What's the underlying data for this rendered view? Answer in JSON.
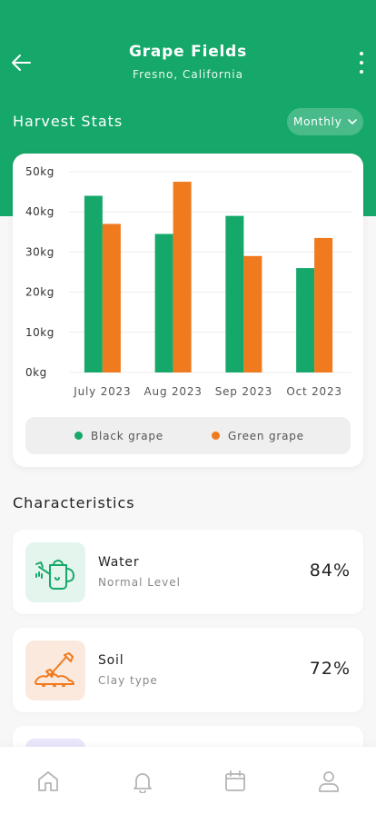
{
  "header": {
    "title": "Grape Fields",
    "subtitle": "Fresno, California",
    "back_icon": "arrow-left-icon",
    "menu_icon": "more-vertical-icon"
  },
  "stats": {
    "heading": "Harvest Stats",
    "range_label": "Monthly",
    "range_icon": "chevron-down-icon"
  },
  "chart_data": {
    "type": "bar",
    "categories": [
      "July 2023",
      "Aug 2023",
      "Sep 2023",
      "Oct 2023"
    ],
    "series": [
      {
        "name": "Black grape",
        "color": "#16a86a",
        "values": [
          44,
          34.5,
          39,
          26
        ]
      },
      {
        "name": "Green grape",
        "color": "#f07a1e",
        "values": [
          37,
          47.5,
          29,
          33.5
        ]
      }
    ],
    "yticks": [
      "0kg",
      "10kg",
      "20kg",
      "30kg",
      "40kg",
      "50kg"
    ],
    "ylim": [
      0,
      50
    ],
    "grid": true,
    "legend": "bottom"
  },
  "characteristics": {
    "heading": "Characteristics",
    "items": [
      {
        "name": "Water",
        "desc": "Normal Level",
        "value": "84%",
        "icon": "watering-can-icon",
        "bg": "#e3f5ec",
        "color": "#16a86a"
      },
      {
        "name": "Soil",
        "desc": "Clay type",
        "value": "72%",
        "icon": "shovel-soil-icon",
        "bg": "#fbe9de",
        "color": "#f07a1e"
      }
    ]
  },
  "tabbar": {
    "items": [
      {
        "name": "Home",
        "icon": "home-icon"
      },
      {
        "name": "Notifications",
        "icon": "bell-icon"
      },
      {
        "name": "Calendar",
        "icon": "calendar-icon"
      },
      {
        "name": "Profile",
        "icon": "user-icon"
      }
    ]
  }
}
